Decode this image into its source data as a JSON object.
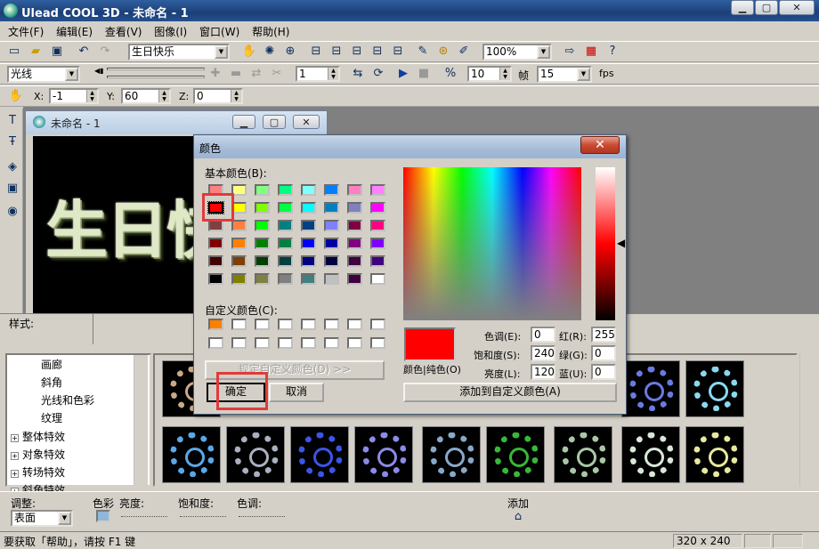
{
  "window": {
    "title": "Ulead COOL 3D - 未命名 - 1",
    "min": "▁",
    "max": "▢",
    "close": "✕"
  },
  "menu": [
    "文件(F)",
    "编辑(E)",
    "查看(V)",
    "图像(I)",
    "窗口(W)",
    "帮助(H)"
  ],
  "toolbar": {
    "text_combo": "生日快乐",
    "zoom": "100%"
  },
  "toolbar2": {
    "object_combo": "光线",
    "frame": "1",
    "fps_value": "10",
    "frame_label": "帧",
    "frame_count": "15",
    "fps_label": "fps"
  },
  "toolbar3": {
    "x_label": "X:",
    "x_value": "-1",
    "y_label": "Y:",
    "y_value": "60",
    "z_label": "Z:",
    "z_value": "0"
  },
  "child_window": {
    "title": "未命名 - 1",
    "canvas_text": "生日快"
  },
  "style_label": "样式:",
  "tree": {
    "items": [
      "画廊",
      "斜角",
      "光线和色彩",
      "纹理"
    ],
    "groups": [
      "整体特效",
      "对象特效",
      "转场特效",
      "斜角特效"
    ]
  },
  "bottom": {
    "adjust_label": "调整:",
    "adjust_value": "表面",
    "color_label": "色彩",
    "brightness_label": "亮度:",
    "saturation_label": "饱和度:",
    "hue_label": "色调:",
    "add_label": "添加"
  },
  "status": {
    "help_text": "要获取「帮助」，请按 F1 键",
    "size": "320 x 240"
  },
  "dialog": {
    "title": "颜色",
    "close": "✕",
    "basic_label": "基本颜色(B):",
    "custom_label": "自定义颜色(C):",
    "define_button": "规定自定义颜色(D) >>",
    "ok_button": "确定",
    "cancel_button": "取消",
    "add_custom_button": "添加到自定义颜色(A)",
    "solid_label": "颜色|纯色(O)",
    "hue_label": "色调(E):",
    "hue": "0",
    "sat_label": "饱和度(S):",
    "sat": "240",
    "lum_label": "亮度(L):",
    "lum": "120",
    "red_label": "红(R):",
    "red": "255",
    "green_label": "绿(G):",
    "green": "0",
    "blue_label": "蓝(U):",
    "blue": "0",
    "basic_colors": [
      "#ff8080",
      "#ffff80",
      "#80ff80",
      "#00ff80",
      "#80ffff",
      "#0080ff",
      "#ff80c0",
      "#ff80ff",
      "#ff0000",
      "#ffff00",
      "#80ff00",
      "#00ff40",
      "#00ffff",
      "#0080c0",
      "#8080c0",
      "#ff00ff",
      "#804040",
      "#ff8040",
      "#00ff00",
      "#008080",
      "#004080",
      "#8080ff",
      "#800040",
      "#ff0080",
      "#800000",
      "#ff8000",
      "#008000",
      "#008040",
      "#0000ff",
      "#0000a0",
      "#800080",
      "#8000ff",
      "#400000",
      "#804000",
      "#004000",
      "#004040",
      "#000080",
      "#000040",
      "#400040",
      "#400080",
      "#000000",
      "#808000",
      "#808040",
      "#808080",
      "#408080",
      "#c0c0c0",
      "#400040",
      "#ffffff"
    ],
    "custom_colors": [
      "#ff8000",
      "#ffffff",
      "#ffffff",
      "#ffffff",
      "#ffffff",
      "#ffffff",
      "#ffffff",
      "#ffffff",
      "#ffffff",
      "#ffffff",
      "#ffffff",
      "#ffffff",
      "#ffffff",
      "#ffffff",
      "#ffffff",
      "#ffffff"
    ],
    "selected_color": "#ff0000"
  },
  "thumb_colors": [
    "#c9a98a",
    "#5aa8e8",
    "#a9b0c0",
    "#3a55e8",
    "#8a8ae8",
    "#88a8c8",
    "#38b838",
    "#a8c8a8",
    "#e8e8a0"
  ],
  "thumb_top_colors": [
    "#c9a98a",
    "#6a7ae0",
    "#8ad8f0"
  ]
}
